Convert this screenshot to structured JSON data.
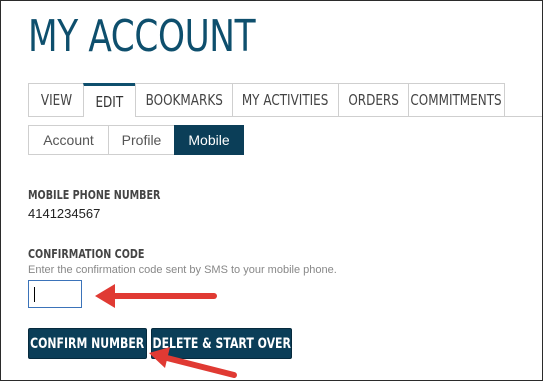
{
  "page": {
    "title": "MY ACCOUNT"
  },
  "tabs": [
    {
      "label": "VIEW"
    },
    {
      "label": "EDIT"
    },
    {
      "label": "BOOKMARKS"
    },
    {
      "label": "MY ACTIVITIES"
    },
    {
      "label": "ORDERS"
    },
    {
      "label": "COMMITMENTS"
    }
  ],
  "subtabs": [
    {
      "label": "Account"
    },
    {
      "label": "Profile"
    },
    {
      "label": "Mobile"
    }
  ],
  "mobile": {
    "phone_label": "MOBILE PHONE NUMBER",
    "phone_value": "4141234567",
    "code_label": "CONFIRMATION CODE",
    "code_help": "Enter the confirmation code sent by SMS to your mobile phone.",
    "code_value": ""
  },
  "buttons": {
    "confirm": "CONFIRM NUMBER",
    "delete": "DELETE & START OVER"
  },
  "colors": {
    "brand": "#0e4f6d",
    "button": "#0b3e58",
    "annotation": "#e03a33"
  },
  "icons": [
    "annotation-arrow",
    "annotation-arrow"
  ]
}
